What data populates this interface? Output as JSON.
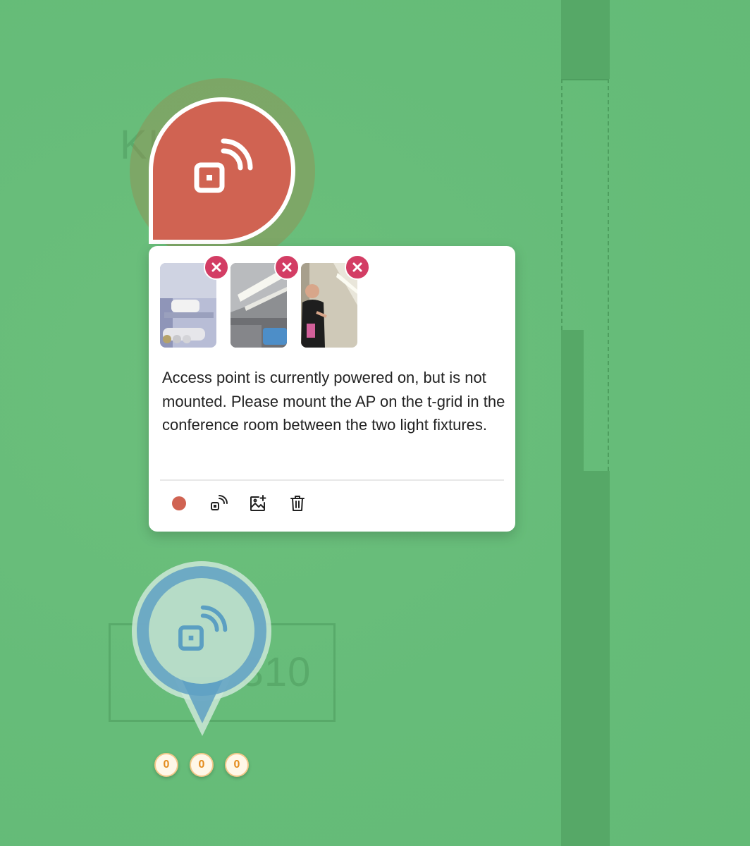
{
  "map": {
    "room_label_top": "KI 250",
    "room_label_bottom": "15.310"
  },
  "selected_pin": {
    "color": "#d06352",
    "icon": "access-point-icon"
  },
  "popup": {
    "photos": [
      {
        "alt": "access point on desk",
        "remove_icon": "close-icon"
      },
      {
        "alt": "ceiling light fixtures",
        "remove_icon": "close-icon"
      },
      {
        "alt": "person pointing at ceiling",
        "remove_icon": "close-icon"
      }
    ],
    "note": "Access point is currently powered on, but is not mounted. Please mount the AP on the t-grid in the conference room between the two light fixtures.",
    "actions": [
      {
        "name": "status-color",
        "icon": "color-dot-icon",
        "color": "#d06352"
      },
      {
        "name": "device-type",
        "icon": "access-point-icon"
      },
      {
        "name": "add-photo",
        "icon": "add-image-icon"
      },
      {
        "name": "delete",
        "icon": "trash-icon"
      }
    ]
  },
  "other_pin": {
    "color": "#5fa0c3",
    "icon": "access-point-icon",
    "badges": [
      "0",
      "0",
      "0"
    ]
  }
}
